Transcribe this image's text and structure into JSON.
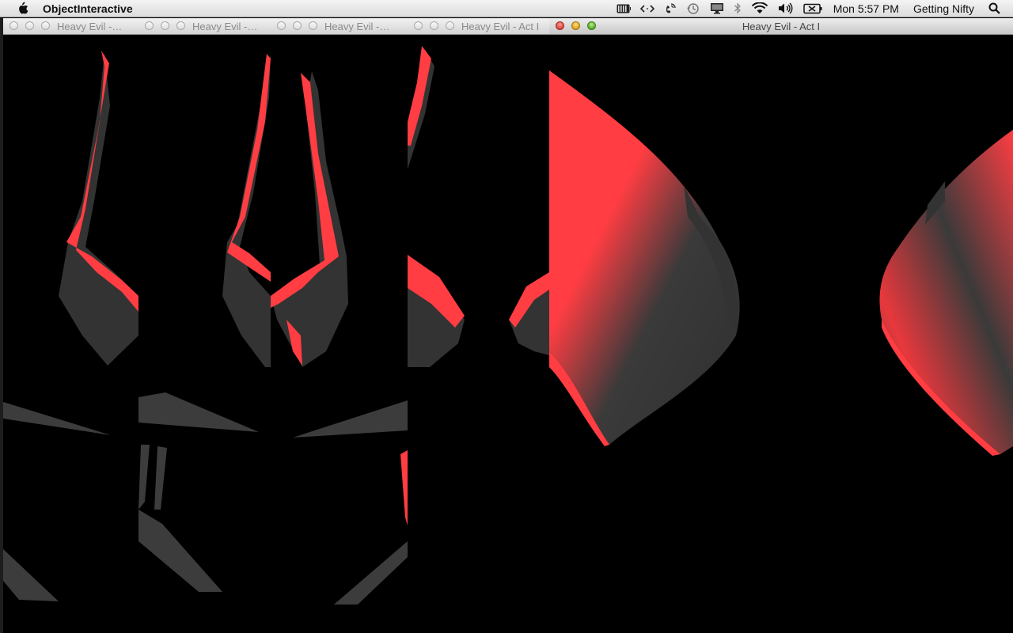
{
  "menubar": {
    "app_name": "ObjectInteractive",
    "clock": "Mon 5:57 PM",
    "user": "Getting Nifty",
    "icons": [
      "apple-icon",
      "battery-meter-icon",
      "code-brackets-icon",
      "phone-signal-icon",
      "time-machine-icon",
      "display-icon",
      "bluetooth-icon",
      "wifi-icon",
      "volume-icon",
      "battery-icon",
      "search-icon"
    ]
  },
  "windows": [
    {
      "title": "Heavy Evil -…"
    },
    {
      "title": "Heavy Evil -…"
    },
    {
      "title": "Heavy Evil -…"
    },
    {
      "title": "Heavy Evil - Act I"
    },
    {
      "title": "Heavy Evil - Act I"
    }
  ],
  "colors": {
    "accent_red": "#ff3d42",
    "model_gray": "#3a3a3a",
    "background": "#000000"
  }
}
